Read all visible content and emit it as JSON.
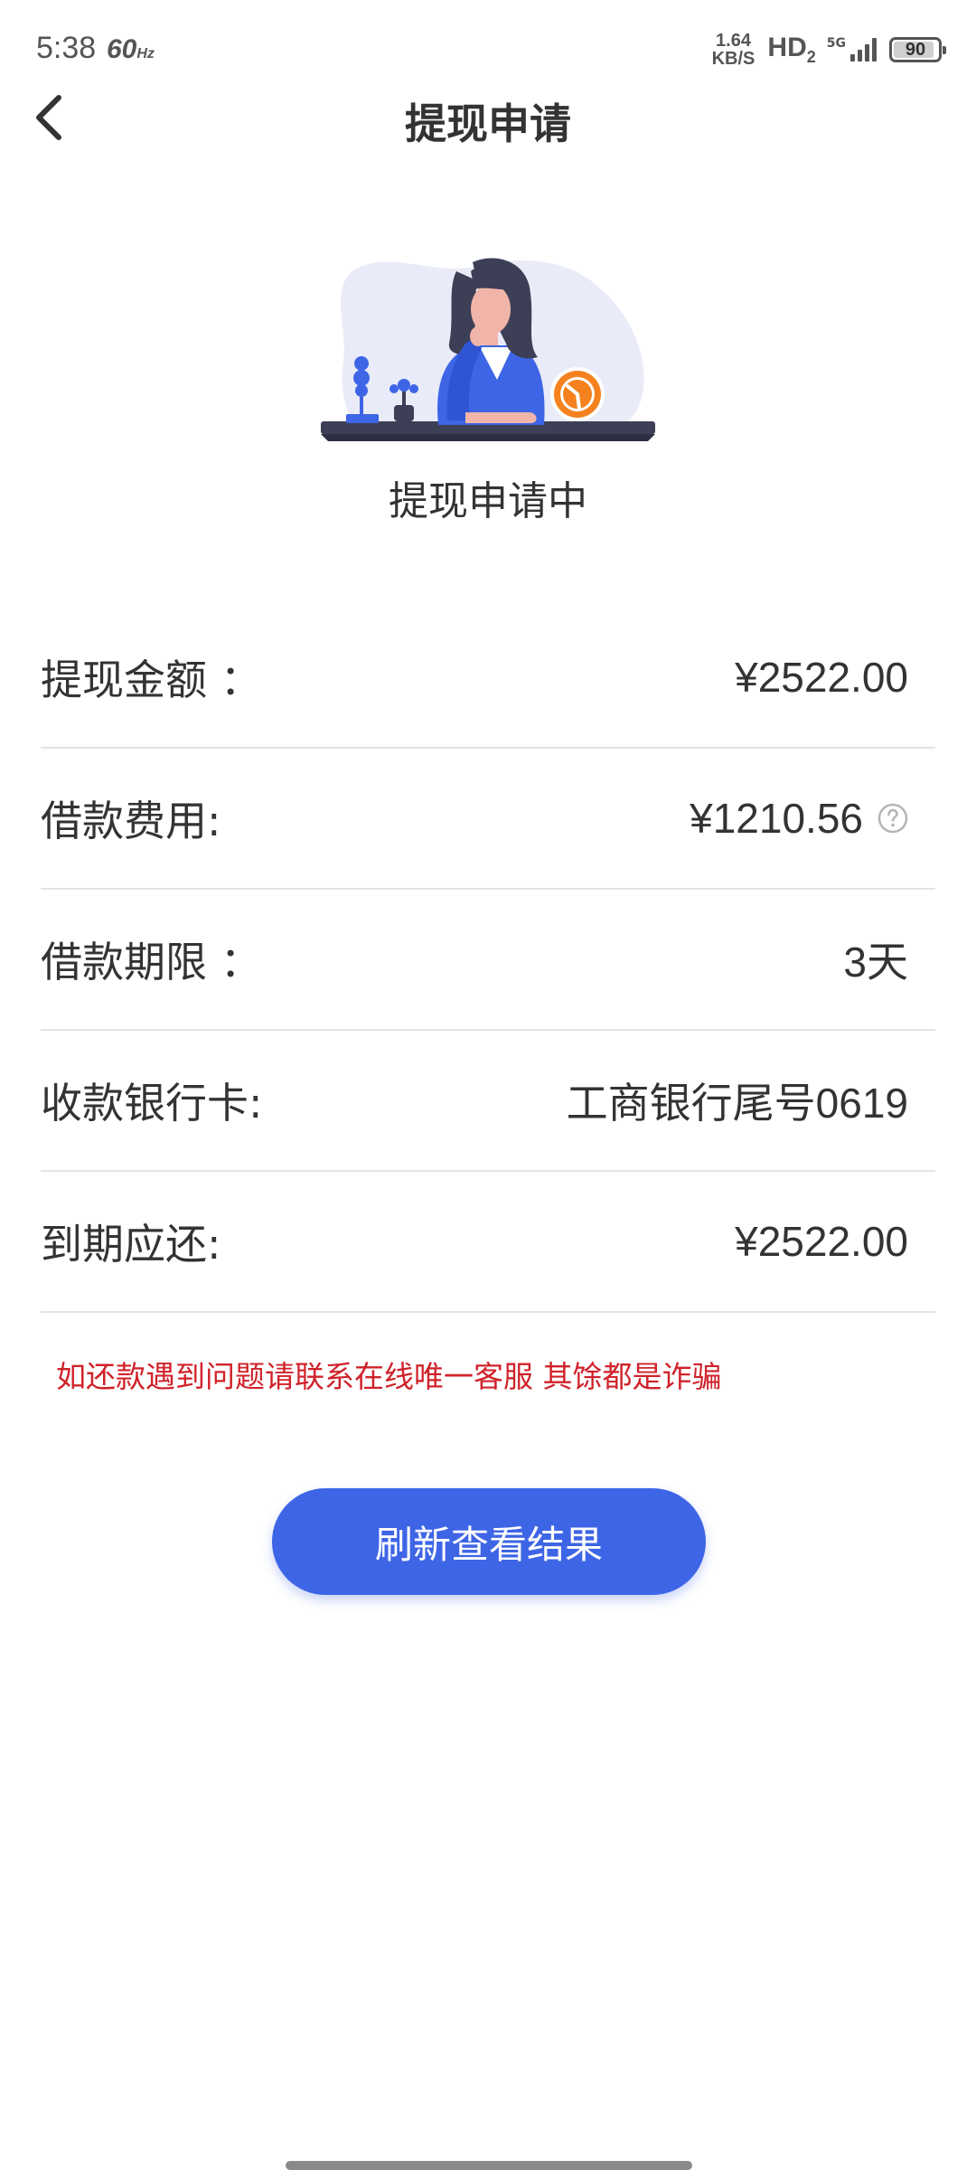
{
  "status_bar": {
    "time": "5:38",
    "refresh_rate": "60",
    "refresh_unit": "Hz",
    "net_speed_value": "1.64",
    "net_speed_unit": "KB/S",
    "hd_label": "HD",
    "hd_sub": "2",
    "network_type": "5G",
    "battery_level": "90"
  },
  "header": {
    "title": "提现申请",
    "back_icon": "chevron-left-icon"
  },
  "status": {
    "caption": "提现申请中",
    "illustration": "woman-at-desk-with-clock-illustration"
  },
  "info_rows": [
    {
      "label": "提现金额 ：",
      "value": "¥2522.00"
    },
    {
      "label": "借款费用:",
      "value": "¥1210.56",
      "icon": "question-circle-icon"
    },
    {
      "label": "借款期限 ：",
      "value": "3天"
    },
    {
      "label": "收款银行卡:",
      "value": "工商银行尾号0619"
    },
    {
      "label": "到期应还:",
      "value": "¥2522.00"
    }
  ],
  "warning": "如还款遇到问题请联系在线唯一客服 其馀都是诈骗",
  "refresh_button": "刷新查看结果",
  "colors": {
    "primary": "#3e65e6",
    "warning": "#d0222a",
    "text": "#333333",
    "divider": "#e3e3e3"
  }
}
